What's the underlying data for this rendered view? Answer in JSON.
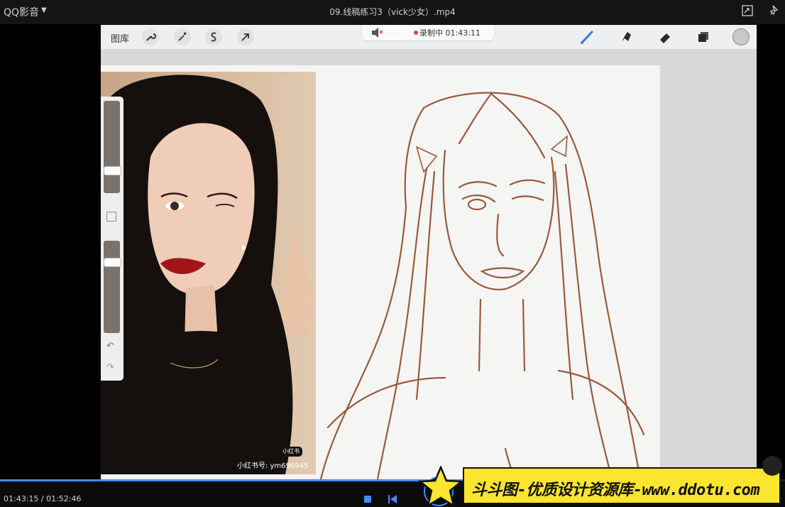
{
  "window": {
    "app_name": "QQ影音",
    "file_title": "09.线稿练习3（vick少女）.mp4"
  },
  "procreate": {
    "gallery_label": "图库",
    "recording_label": "录制中 01:43:11"
  },
  "photo": {
    "tag": "小红书",
    "handle": "小红书号: ym696945"
  },
  "playback": {
    "time": "01:43:15 / 01:52:46",
    "progress": 0.915
  },
  "banner": {
    "text": "斗斗图-优质设计资源库-www.ddotu.com"
  },
  "colors": {
    "accent": "#3f8df2",
    "brush_blue": "#2f7fd8",
    "sketch_brown": "#9a5a3c",
    "banner_yellow": "#fbe52f"
  }
}
